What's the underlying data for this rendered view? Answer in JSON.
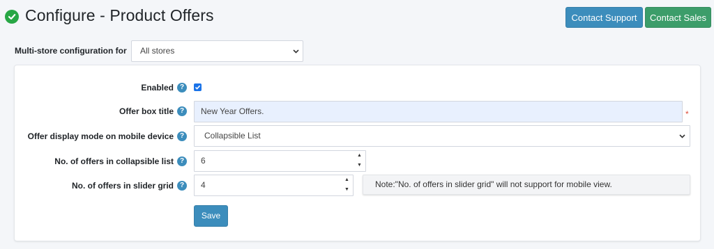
{
  "header": {
    "title": "Configure - Product Offers",
    "contact_support_label": "Contact Support",
    "contact_sales_label": "Contact Sales"
  },
  "store": {
    "label": "Multi-store configuration for",
    "selected": "All stores"
  },
  "form": {
    "enabled": {
      "label": "Enabled",
      "checked": true
    },
    "offer_box_title": {
      "label": "Offer box title",
      "value": "New Year Offers.",
      "required_mark": "*"
    },
    "display_mode": {
      "label": "Offer display mode on mobile device",
      "selected": "Collapsible List"
    },
    "collapsible_count": {
      "label": "No. of offers in collapsible list",
      "value": "6"
    },
    "slider_count": {
      "label": "No. of offers in slider grid",
      "value": "4"
    },
    "note": "Note:\"No. of offers in slider grid\" will not support for mobile view.",
    "help_glyph": "?",
    "save_label": "Save"
  },
  "colors": {
    "primary": "#3c8dbc",
    "success": "#3c9d6a",
    "check_icon": "#28a745",
    "required": "#dd4b39"
  },
  "icons": [
    "check-circle-icon",
    "chevron-down-icon",
    "question-circle-icon",
    "spin-up-icon",
    "spin-down-icon"
  ]
}
